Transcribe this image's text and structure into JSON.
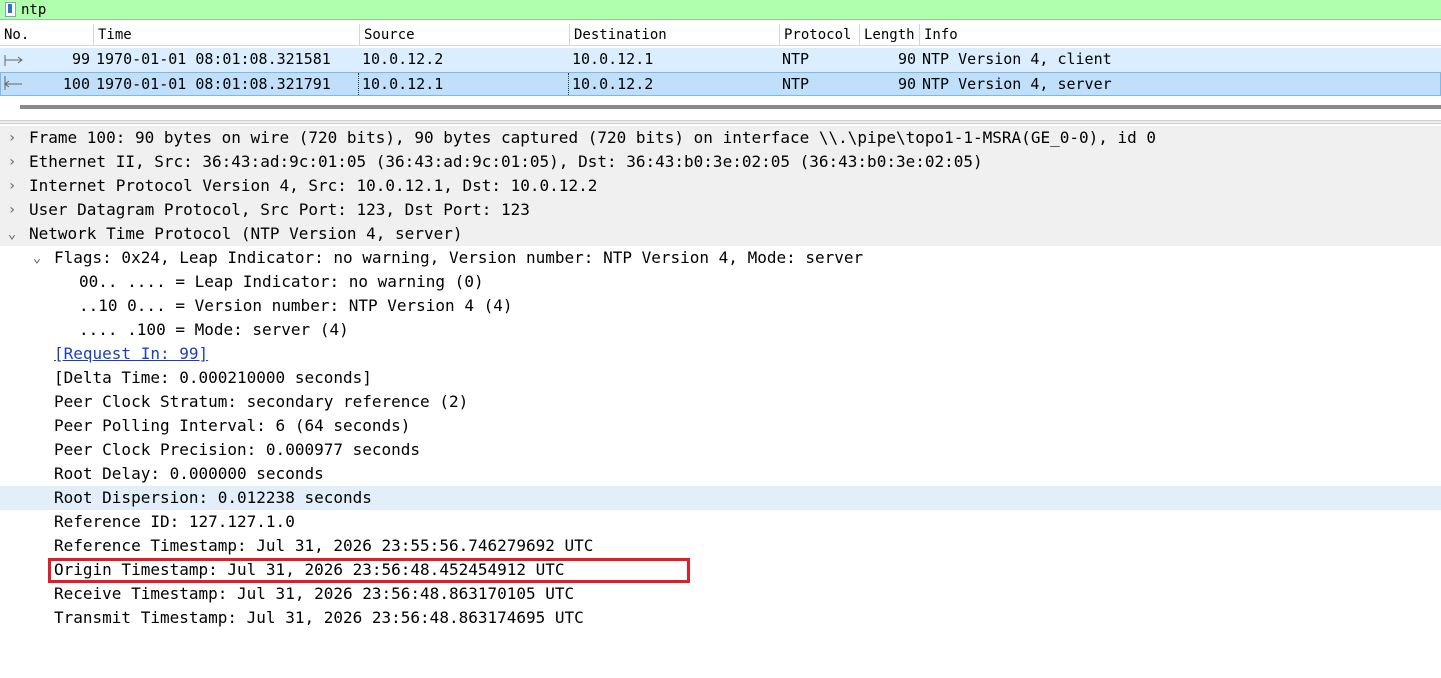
{
  "filter": {
    "value": "ntp"
  },
  "packet_list": {
    "columns": [
      "No.",
      "Time",
      "Source",
      "Destination",
      "Protocol",
      "Length",
      "Info"
    ],
    "rows": [
      {
        "no": "99",
        "time": "1970-01-01 08:01:08.321581",
        "source": "10.0.12.2",
        "destination": "10.0.12.1",
        "protocol": "NTP",
        "length": "90",
        "info": "NTP Version 4, client"
      },
      {
        "no": "100",
        "time": "1970-01-01 08:01:08.321791",
        "source": "10.0.12.1",
        "destination": "10.0.12.2",
        "protocol": "NTP",
        "length": "90",
        "info": "NTP Version 4, server"
      }
    ]
  },
  "details": [
    {
      "text": "Frame 100: 90 bytes on wire (720 bits), 90 bytes captured (720 bits) on interface \\\\.\\pipe\\topo1-1-MSRA(GE_0-0), id 0",
      "level": 0,
      "toggle": "›"
    },
    {
      "text": "Ethernet II, Src: 36:43:ad:9c:01:05 (36:43:ad:9c:01:05), Dst: 36:43:b0:3e:02:05 (36:43:b0:3e:02:05)",
      "level": 0,
      "toggle": "›"
    },
    {
      "text": "Internet Protocol Version 4, Src: 10.0.12.1, Dst: 10.0.12.2",
      "level": 0,
      "toggle": "›"
    },
    {
      "text": "User Datagram Protocol, Src Port: 123, Dst Port: 123",
      "level": 0,
      "toggle": "›"
    },
    {
      "text": "Network Time Protocol (NTP Version 4, server)",
      "level": 0,
      "toggle": "⌄"
    },
    {
      "text": "Flags: 0x24, Leap Indicator: no warning, Version number: NTP Version 4, Mode: server",
      "level": 1,
      "toggle": "⌄"
    },
    {
      "text": "00.. .... = Leap Indicator: no warning (0)",
      "level": 2
    },
    {
      "text": "..10 0... = Version number: NTP Version 4 (4)",
      "level": 2
    },
    {
      "text": ".... .100 = Mode: server (4)",
      "level": 2
    },
    {
      "text": "[Request In: 99]",
      "level": 1,
      "link": true
    },
    {
      "text": "[Delta Time: 0.000210000 seconds]",
      "level": 1
    },
    {
      "text": "Peer Clock Stratum: secondary reference (2)",
      "level": 1
    },
    {
      "text": "Peer Polling Interval: 6 (64 seconds)",
      "level": 1
    },
    {
      "text": "Peer Clock Precision: 0.000977 seconds",
      "level": 1
    },
    {
      "text": "Root Delay: 0.000000 seconds",
      "level": 1
    },
    {
      "text": "Root Dispersion: 0.012238 seconds",
      "level": 1
    },
    {
      "text": "Reference ID: 127.127.1.0",
      "level": 1
    },
    {
      "text": "Reference Timestamp: Jul 31, 2026 23:55:56.746279692 UTC",
      "level": 1
    },
    {
      "text": "Origin Timestamp: Jul 31, 2026 23:56:48.452454912 UTC",
      "level": 1
    },
    {
      "text": "Receive Timestamp: Jul 31, 2026 23:56:48.863170105 UTC",
      "level": 1
    },
    {
      "text": "Transmit Timestamp: Jul 31, 2026 23:56:48.863174695 UTC",
      "level": 1
    }
  ],
  "colors": {
    "filter_valid": "#afffaf",
    "row_selected": "#bfdffa",
    "row_related": "#daeeff",
    "highlight": "#e01e2b",
    "link": "#1a3fc4"
  }
}
